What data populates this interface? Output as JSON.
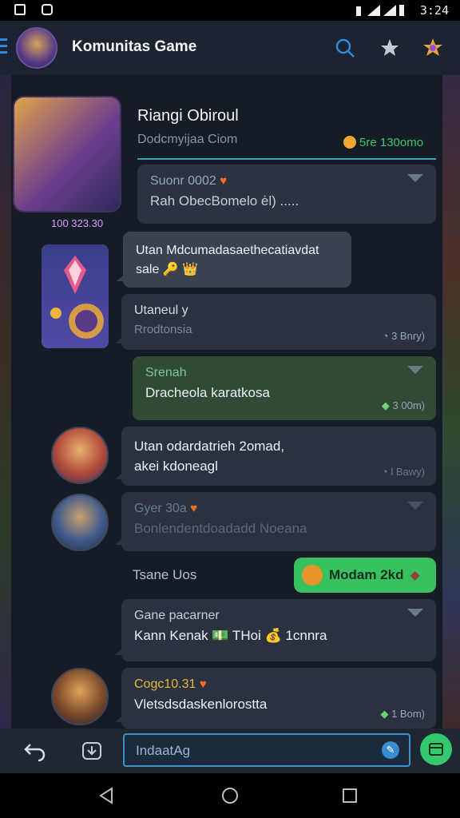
{
  "status_bar": {
    "time": "3:24"
  },
  "app_bar": {
    "title": "Komunitas Game"
  },
  "header_card": {
    "title": "Riangi Obiroul",
    "subtitle": "Dodcmyijaa Ciom",
    "badge": "5re 130omo",
    "caption": "100 323.30",
    "quoted_sender": "Suonr 0002",
    "quoted_text": "Rah ObecBomelo ėl) ....."
  },
  "messages": [
    {
      "text": "Utan Mdcumadasaethecatiavdat sale 🔑 👑"
    },
    {
      "sender": "Utaneul y",
      "text": "Rrodtonsia",
      "time": "3 Bnry)"
    },
    {
      "sender": "Srenah",
      "text": "Dracheola karatkosa",
      "time": "3 00m)"
    },
    {
      "text": "Utan odardatrieh 2omad, akei kdoneagl",
      "time": "l Bawy)"
    },
    {
      "sender": "Gyer 30a",
      "text": "Bonlendentdoadadd Noeana"
    },
    {
      "label": "Tsane Uos",
      "chip": "Modam 2kd"
    },
    {
      "sender": "Gane pacarner",
      "text": "Kann Kenak 💵 THoi 💰 1cnnra"
    },
    {
      "sender": "Cogc10.31",
      "text": "Vletsdsdaskenlorostta",
      "time": "1 Bom)"
    }
  ],
  "input": {
    "placeholder": "IndaatAg"
  },
  "colors": {
    "accent_blue": "#2f8bdc",
    "accent_green": "#34c96f",
    "bubble": "#2a3240",
    "bubble_green": "#2f4a35"
  }
}
